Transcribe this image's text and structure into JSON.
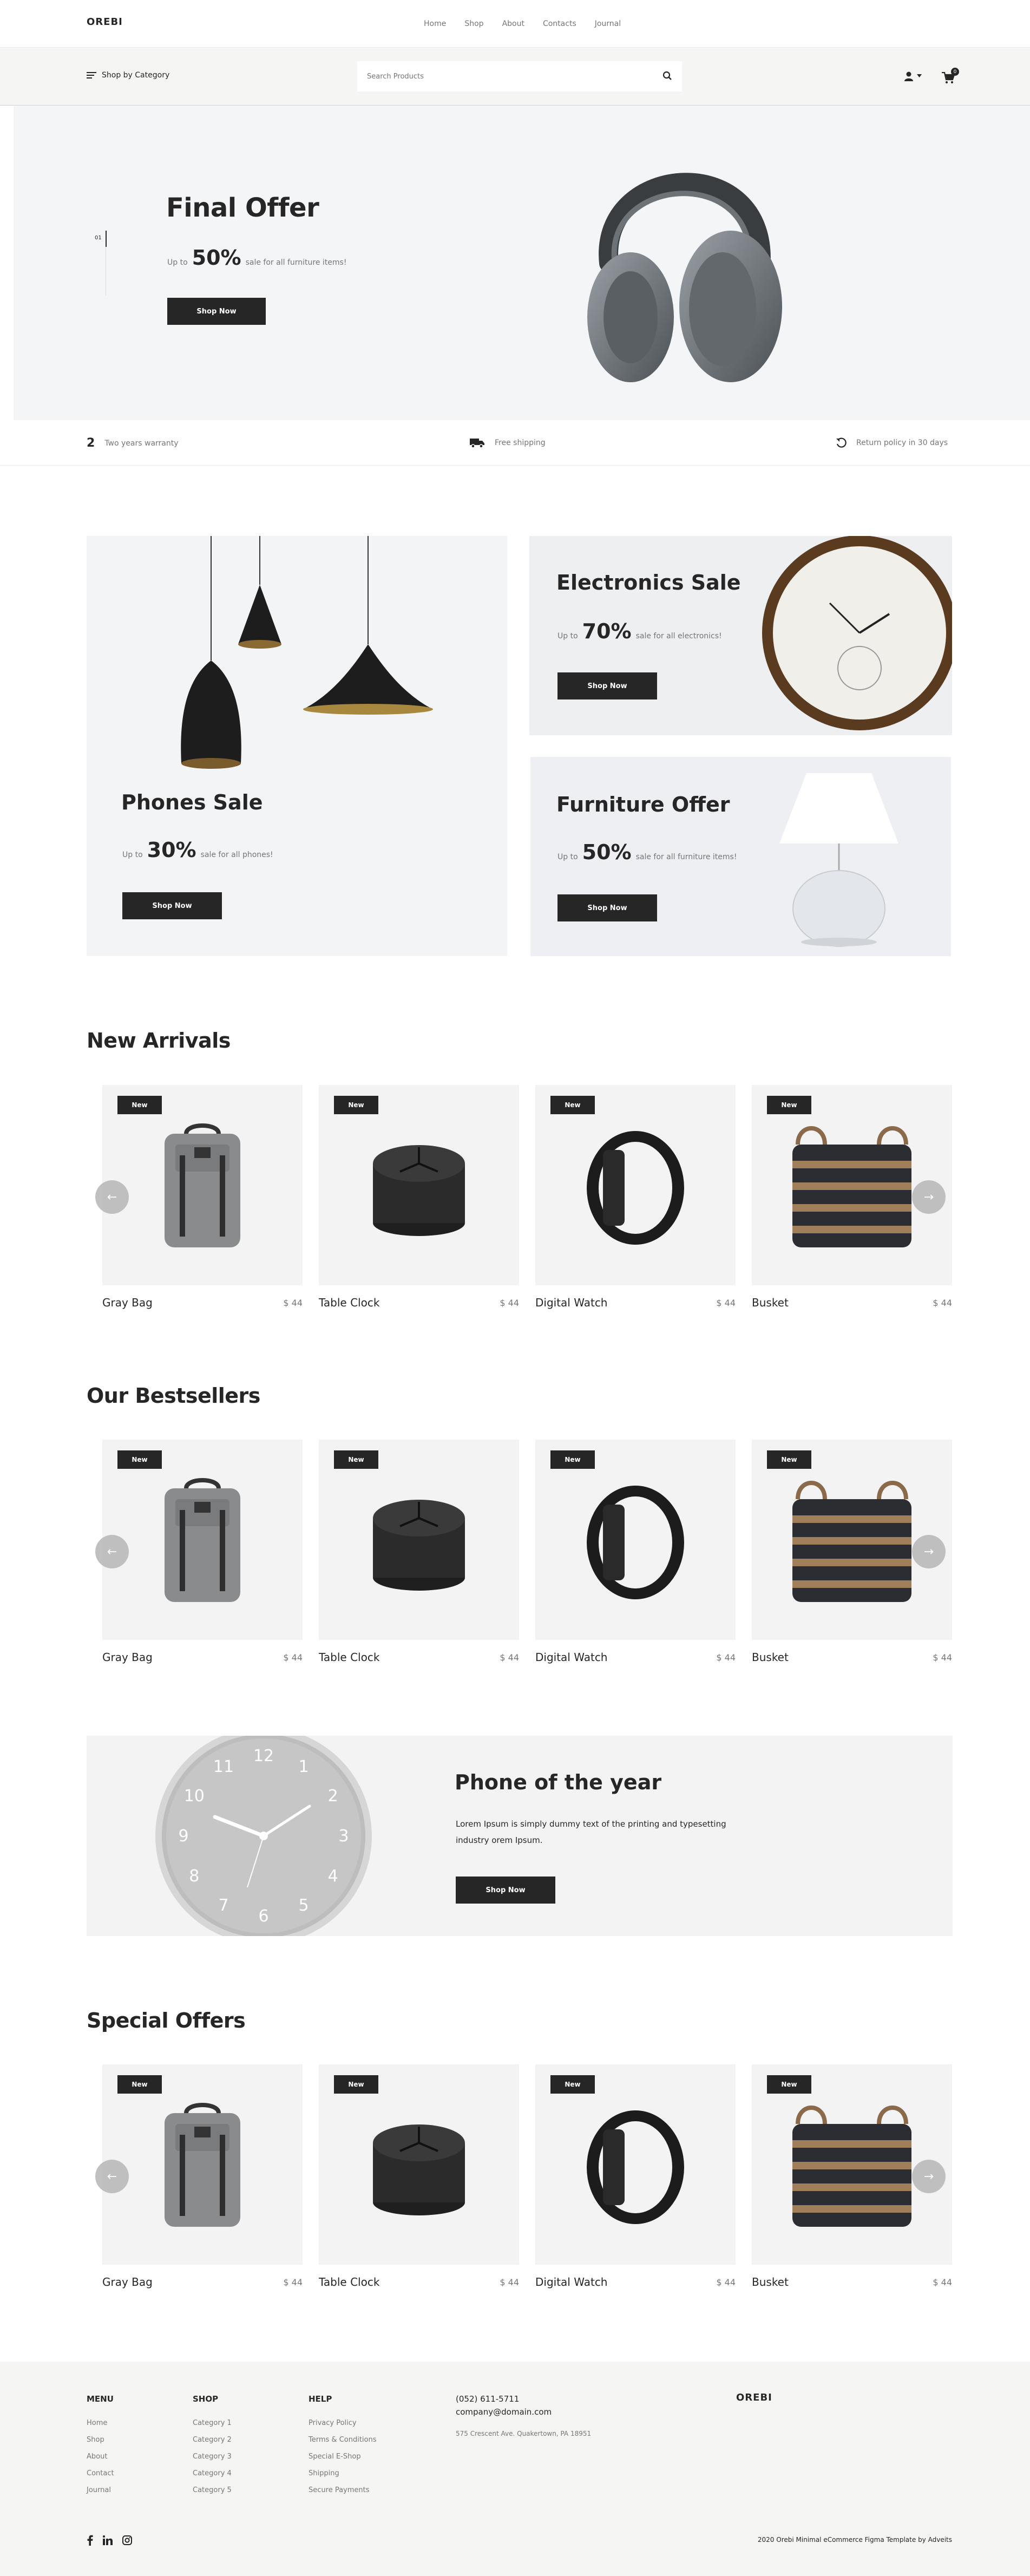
{
  "header": {
    "logo": "OREBI",
    "nav": [
      "Home",
      "Shop",
      "About",
      "Contacts",
      "Journal"
    ]
  },
  "toolbar": {
    "category_label": "Shop by Category",
    "search_placeholder": "Search Products",
    "cart_count": "0"
  },
  "hero": {
    "pager": "01",
    "title": "Final Offer",
    "up_to": "Up to",
    "percent": "50%",
    "desc": "sale for all furniture items!",
    "button": "Shop Now"
  },
  "features": {
    "warranty_num": "2",
    "warranty": "Two years warranty",
    "shipping": "Free shipping",
    "returns": "Return policy in 30 days"
  },
  "promos": {
    "phones": {
      "title": "Phones Sale",
      "up_to": "Up to",
      "percent": "30%",
      "desc": "sale for all phones!",
      "button": "Shop Now"
    },
    "electronics": {
      "title": "Electronics Sale",
      "up_to": "Up to",
      "percent": "70%",
      "desc": "sale for all electronics!",
      "button": "Shop Now"
    },
    "furniture": {
      "title": "Furniture Offer",
      "up_to": "Up to",
      "percent": "50%",
      "desc": "sale for all furniture items!",
      "button": "Shop Now"
    }
  },
  "new_arrivals": {
    "title": "New Arrivals",
    "products": [
      {
        "badge": "New",
        "name": "Gray Bag",
        "price": "$ 44"
      },
      {
        "badge": "New",
        "name": "Table Clock",
        "price": "$ 44"
      },
      {
        "badge": "New",
        "name": "Digital Watch",
        "price": "$ 44"
      },
      {
        "badge": "New",
        "name": "Busket",
        "price": "$ 44"
      }
    ]
  },
  "bestsellers": {
    "title": "Our Bestsellers",
    "products": [
      {
        "badge": "New",
        "name": "Gray Bag",
        "price": "$ 44"
      },
      {
        "badge": "New",
        "name": "Table Clock",
        "price": "$ 44"
      },
      {
        "badge": "New",
        "name": "Digital Watch",
        "price": "$ 44"
      },
      {
        "badge": "New",
        "name": "Busket",
        "price": "$ 44"
      }
    ]
  },
  "phone_of_year": {
    "title": "Phone of the year",
    "text": "Lorem Ipsum is simply dummy text of the printing and typesetting industry orem Ipsum.",
    "button": "Shop Now",
    "clock_numbers": [
      "12",
      "1",
      "2",
      "3",
      "4",
      "5",
      "6",
      "7",
      "8",
      "9",
      "10",
      "11"
    ]
  },
  "special_offers": {
    "title": "Special Offers",
    "products": [
      {
        "badge": "New",
        "name": "Gray Bag",
        "price": "$ 44"
      },
      {
        "badge": "New",
        "name": "Table Clock",
        "price": "$ 44"
      },
      {
        "badge": "New",
        "name": "Digital Watch",
        "price": "$ 44"
      },
      {
        "badge": "New",
        "name": "Busket",
        "price": "$ 44"
      }
    ]
  },
  "footer": {
    "menu": {
      "title": "MENU",
      "items": [
        "Home",
        "Shop",
        "About",
        "Contact",
        "Journal"
      ]
    },
    "shop": {
      "title": "SHOP",
      "items": [
        "Category 1",
        "Category 2",
        "Category 3",
        "Category 4",
        "Category 5"
      ]
    },
    "help": {
      "title": "HELP",
      "items": [
        "Privacy Policy",
        "Terms & Conditions",
        "Special E-Shop",
        "Shipping",
        "Secure Payments"
      ]
    },
    "phone": "(052) 611-5711",
    "email": "company@domain.com",
    "address": "575 Crescent Ave. Quakertown, PA 18951",
    "logo": "OREBI",
    "copyright": "2020 Orebi Minimal eCommerce Figma Template by Adveits",
    "social_icons": [
      "facebook-icon",
      "linkedin-icon",
      "instagram-icon"
    ]
  }
}
